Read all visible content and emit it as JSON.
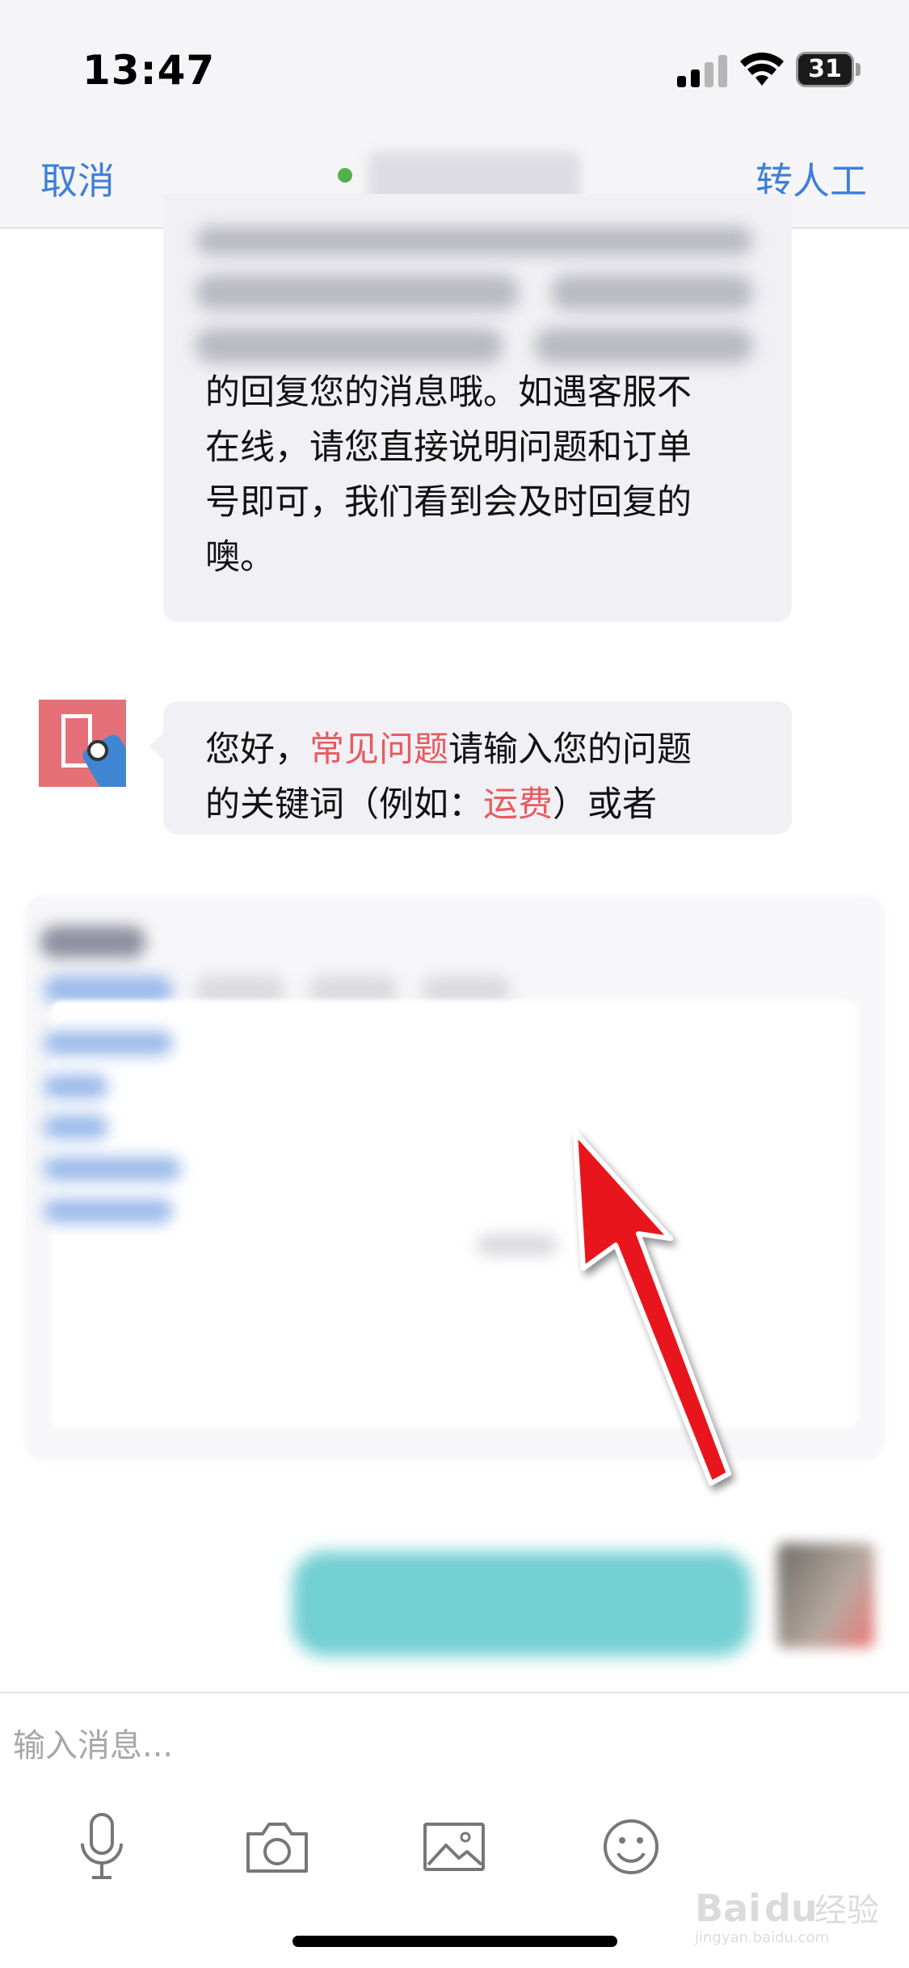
{
  "status": {
    "time": "13:47",
    "battery_level": "31"
  },
  "nav": {
    "cancel_label": "取消",
    "transfer_label": "转人工"
  },
  "chat": {
    "bubble1_lines": [
      "的回复您的消息哦。如遇客服不",
      "在线，请您直接说明问题和订单",
      "号即可，我们看到会及时回复的",
      "噢。"
    ],
    "bubble2": {
      "prefix": "您好，",
      "link1": "常见问题",
      "after_link1": "请输入您的问题",
      "line2_prefix": "的关键词（例如：",
      "link2": "运费",
      "line2_suffix": "）或者"
    }
  },
  "input": {
    "placeholder": "输入消息..."
  },
  "toolbar": {
    "icons": [
      "microphone-icon",
      "camera-icon",
      "image-icon",
      "emoji-icon"
    ]
  },
  "watermark": {
    "text": "Baidu经验",
    "subtext": "jingyan.baidu.com"
  },
  "colors": {
    "accent_blue": "#3e7fd8",
    "link_red": "#e85a5f",
    "online_green": "#52b14a",
    "bubble_bg": "#f1f1f5"
  }
}
